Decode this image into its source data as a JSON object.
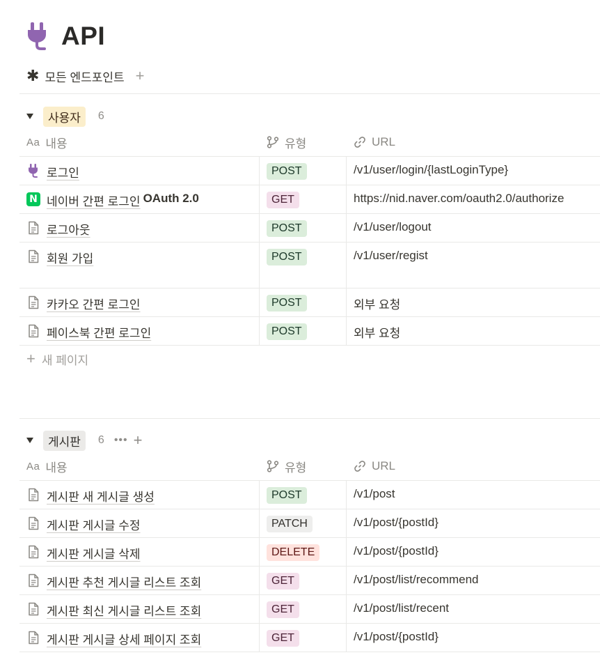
{
  "page": {
    "title": "API",
    "title_icon": "plug-icon",
    "title_icon_color": "#9065b0"
  },
  "view": {
    "tab_label": "모든 엔드포인트",
    "tab_icon": "asterisk-icon",
    "add_view_icon": "plus-icon"
  },
  "columns": {
    "name": "내용",
    "name_icon": "Aa",
    "type": "유형",
    "url": "URL"
  },
  "groups": [
    {
      "label": "사용자",
      "count": "6",
      "color": "#fbeecb",
      "rows": [
        {
          "icon": "plug-icon",
          "name": "로그인",
          "suffix": "",
          "type": "POST",
          "url": "/v1/user/login/{lastLoginType}"
        },
        {
          "icon": "naver-n-icon",
          "name": "네이버 간편 로그인",
          "suffix": "OAuth 2.0",
          "type": "GET",
          "url": "https://nid.naver.com/oauth2.0/authorize"
        },
        {
          "icon": "document-icon",
          "name": "로그아웃",
          "suffix": "",
          "type": "POST",
          "url": "/v1/user/logout"
        },
        {
          "icon": "document-icon",
          "name": "회원 가입",
          "suffix": "",
          "type": "POST",
          "url": "/v1/user/regist"
        },
        {
          "icon": "document-icon",
          "name": "카카오 간편 로그인",
          "suffix": "",
          "type": "POST",
          "url": "외부 요청"
        },
        {
          "icon": "document-icon",
          "name": "페이스북 간편 로그인",
          "suffix": "",
          "type": "POST",
          "url": "외부 요청"
        }
      ],
      "new_page_label": "새 페이지"
    },
    {
      "label": "게시판",
      "count": "6",
      "color": "#ebeae8",
      "rows": [
        {
          "icon": "document-icon",
          "name": "게시판 새 게시글 생성",
          "type": "POST",
          "url": "/v1/post"
        },
        {
          "icon": "document-icon",
          "name": "게시판 게시글 수정",
          "type": "PATCH",
          "url": "/v1/post/{postId}"
        },
        {
          "icon": "document-icon",
          "name": "게시판 게시글 삭제",
          "type": "DELETE",
          "url": "/v1/post/{postId}"
        },
        {
          "icon": "document-icon",
          "name": "게시판 추천 게시글 리스트 조회",
          "type": "GET",
          "url": "/v1/post/list/recommend"
        },
        {
          "icon": "document-icon",
          "name": "게시판 최신 게시글 리스트 조회",
          "type": "GET",
          "url": "/v1/post/list/recent"
        },
        {
          "icon": "document-icon",
          "name": "게시판 게시글 상세 페이지 조회",
          "type": "GET",
          "url": "/v1/post/{postId}"
        }
      ]
    }
  ],
  "tag_colors": {
    "POST": "#dbeddb",
    "GET": "#f4dfeb",
    "PATCH": "#eeeeed",
    "DELETE": "#ffe2dd"
  }
}
